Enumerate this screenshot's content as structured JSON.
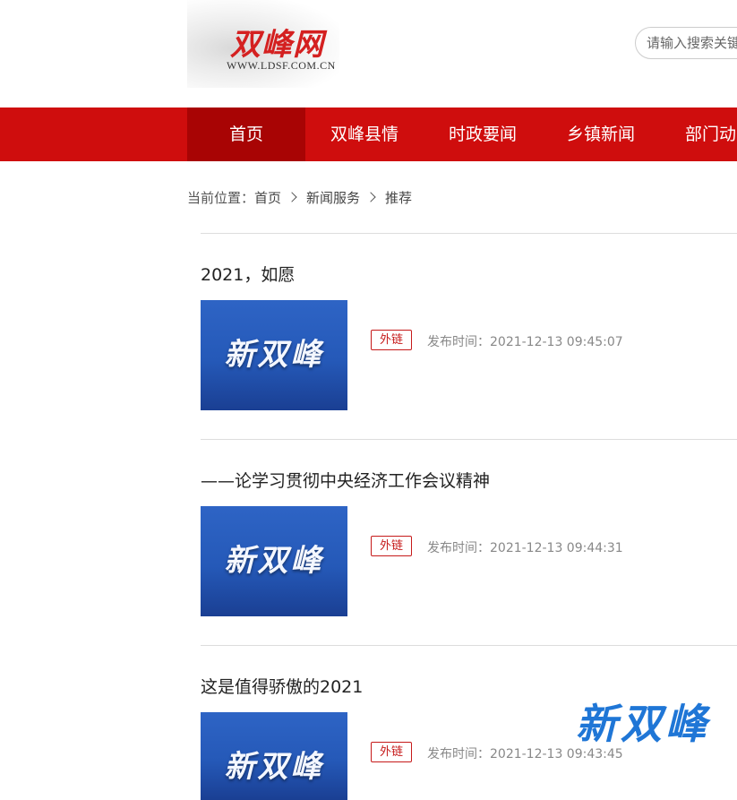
{
  "header": {
    "logo_title": "双峰网",
    "logo_url": "WWW.LDSF.COM.CN",
    "search_placeholder": "请输入搜索关键"
  },
  "nav": [
    {
      "label": "首页",
      "active": true
    },
    {
      "label": "双峰县情"
    },
    {
      "label": "时政要闻"
    },
    {
      "label": "乡镇新闻"
    },
    {
      "label": "部门动态"
    }
  ],
  "breadcrumb": {
    "prefix": "当前位置：",
    "items": [
      "首页",
      "新闻服务",
      "推荐"
    ]
  },
  "news": [
    {
      "title": "2021，如愿",
      "thumb_text": "新双峰",
      "tag": "外链",
      "date_label": "发布时间：",
      "date": "2021-12-13 09:45:07"
    },
    {
      "title": "——论学习贯彻中央经济工作会议精神",
      "thumb_text": "新双峰",
      "tag": "外链",
      "date_label": "发布时间：",
      "date": "2021-12-13 09:44:31"
    },
    {
      "title": "这是值得骄傲的2021",
      "thumb_text": "新双峰",
      "tag": "外链",
      "date_label": "发布时间：",
      "date": "2021-12-13 09:43:45"
    }
  ],
  "floating_logo": "新双峰",
  "colors": {
    "nav_bg": "#cf0d0d",
    "nav_active": "#a80404",
    "tag_red": "#c61a1a",
    "thumb_blue": "#2559b8",
    "float_logo_blue": "#1f76d6"
  }
}
